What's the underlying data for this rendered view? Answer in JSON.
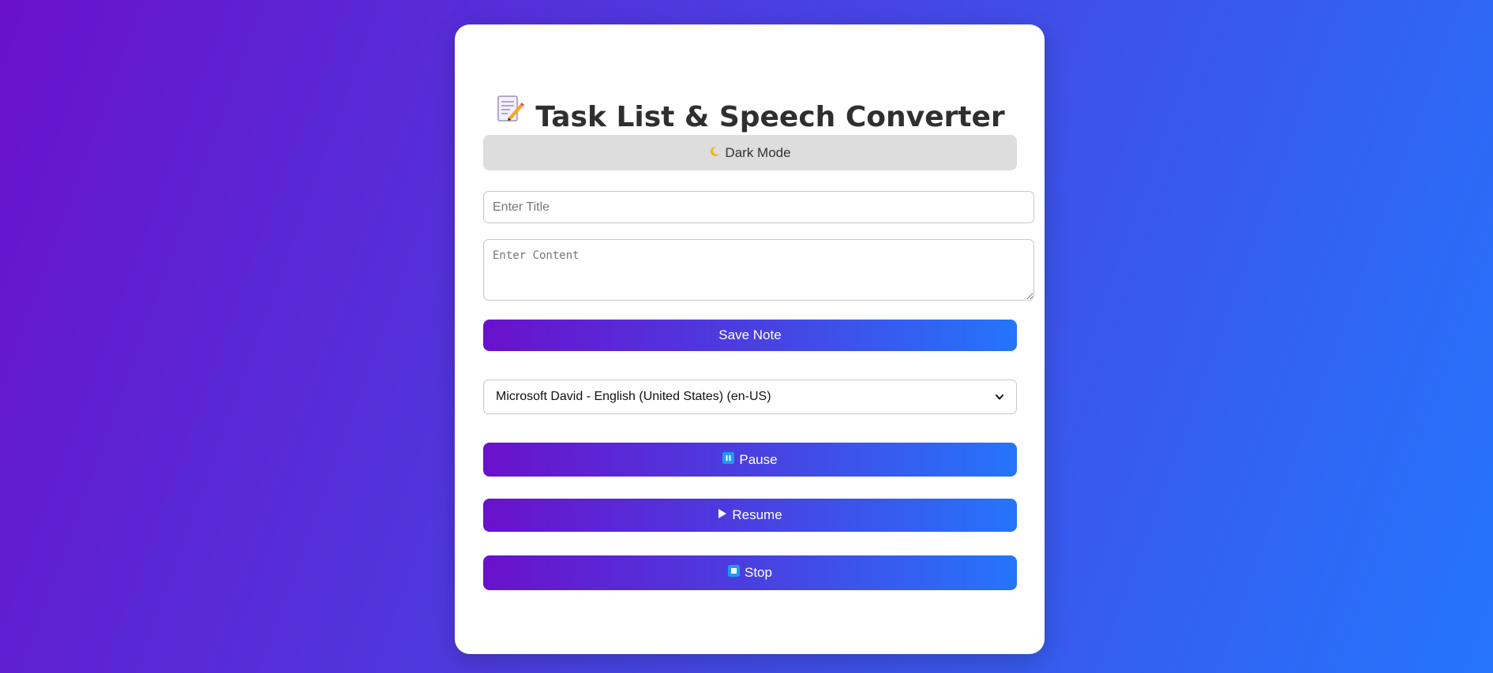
{
  "header": {
    "title": "Task List & Speech Converter",
    "icon": "memo-icon"
  },
  "theme_toggle": {
    "label": "Dark Mode",
    "icon": "crescent-moon-icon"
  },
  "note_form": {
    "title_placeholder": "Enter Title",
    "title_value": "",
    "content_placeholder": "Enter Content",
    "content_value": "",
    "save_label": "Save Note"
  },
  "voice_select": {
    "selected": "Microsoft David - English (United States) (en-US)"
  },
  "playback": {
    "pause_label": "Pause",
    "pause_icon": "pause-icon",
    "resume_label": "Resume",
    "resume_icon": "play-icon",
    "stop_label": "Stop",
    "stop_icon": "stop-icon"
  },
  "colors": {
    "gradient_start": "#6a11cb",
    "gradient_end": "#2575fc",
    "card": "#ffffff",
    "dark_mode_button": "#dddddd"
  }
}
